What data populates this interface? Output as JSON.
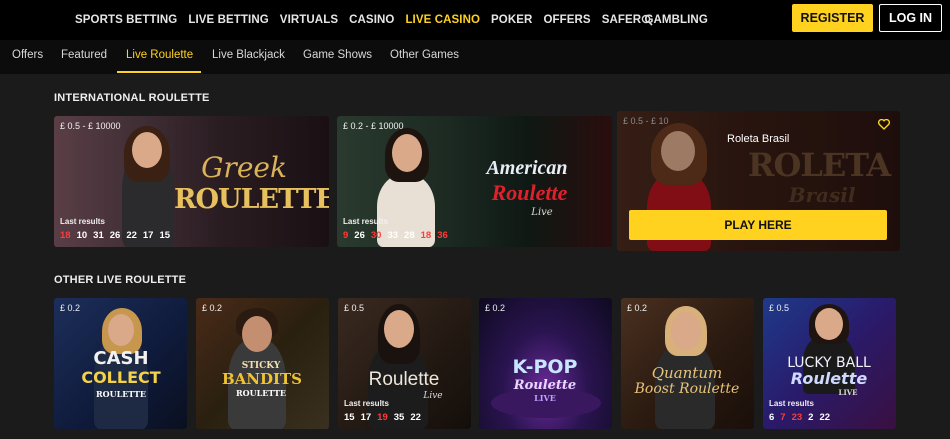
{
  "nav": {
    "items": [
      "SPORTS BETTING",
      "LIVE BETTING",
      "VIRTUALS",
      "CASINO",
      "LIVE CASINO",
      "POKER",
      "OFFERS",
      "SAFER GAMBLING"
    ],
    "active": "LIVE CASINO",
    "search_icon": "search-icon",
    "register": "REGISTER",
    "login": "LOG IN"
  },
  "tabs": [
    "Offers",
    "Featured",
    "Live Roulette",
    "Live Blackjack",
    "Game Shows",
    "Other Games"
  ],
  "active_tab": "Live Roulette",
  "sections": {
    "international": "INTERNATIONAL ROULETTE",
    "other": "OTHER LIVE ROULETTE"
  },
  "international_cards": [
    {
      "price": "£ 0.5  -  £ 10000",
      "logo_line1": "Greek",
      "logo_line2": "ROULETTE",
      "last_results_label": "Last results",
      "results": [
        {
          "n": "18",
          "red": true
        },
        {
          "n": "10",
          "red": false
        },
        {
          "n": "31",
          "red": false
        },
        {
          "n": "26",
          "red": false
        },
        {
          "n": "22",
          "red": false
        },
        {
          "n": "17",
          "red": false
        },
        {
          "n": "15",
          "red": false
        }
      ]
    },
    {
      "price": "£ 0.2  -  £ 10000",
      "logo_line1": "American",
      "logo_line2": "Roulette",
      "logo_line3": "Live",
      "last_results_label": "Last results",
      "results": [
        {
          "n": "9",
          "red": true
        },
        {
          "n": "26",
          "red": false
        },
        {
          "n": "30",
          "red": true
        },
        {
          "n": "33",
          "red": false
        },
        {
          "n": "28",
          "red": false
        },
        {
          "n": "18",
          "red": true
        },
        {
          "n": "36",
          "red": true
        }
      ]
    },
    {
      "price": "£ 0.5  -  £ 10",
      "name": "Roleta Brasil",
      "logo_line1": "ROLETA",
      "logo_line2": "Brasil",
      "play": "PLAY HERE",
      "heart_icon": "heart-icon"
    }
  ],
  "other_cards": [
    {
      "price": "£ 0.2",
      "logo_line1": "CASH",
      "logo_line2": "COLLECT",
      "logo_line3": "ROULETTE"
    },
    {
      "price": "£ 0.2",
      "logo_line1": "STICKY",
      "logo_line2": "BANDITS",
      "logo_line3": "ROULETTE"
    },
    {
      "price": "£ 0.5",
      "logo_line1": "Roulette",
      "logo_line2": "Live",
      "last_results_label": "Last results",
      "results": [
        {
          "n": "15",
          "red": false
        },
        {
          "n": "17",
          "red": false
        },
        {
          "n": "19",
          "red": true
        },
        {
          "n": "35",
          "red": false
        },
        {
          "n": "22",
          "red": false
        }
      ]
    },
    {
      "price": "£ 0.2",
      "logo_line1": "K-POP",
      "logo_line2": "Roulette",
      "logo_line3": "LIVE"
    },
    {
      "price": "£ 0.2",
      "logo_line1": "Quantum",
      "logo_line2": "Boost Roulette"
    },
    {
      "price": "£ 0.5",
      "logo_line1": "LUCKY BALL",
      "logo_line2": "Roulette",
      "logo_line3": "LIVE",
      "last_results_label": "Last results",
      "results": [
        {
          "n": "6",
          "red": false
        },
        {
          "n": "7",
          "red": true
        },
        {
          "n": "23",
          "red": true
        },
        {
          "n": "2",
          "red": false
        },
        {
          "n": "22",
          "red": false
        }
      ]
    }
  ],
  "colors": {
    "accent": "#ffd21f",
    "red_number": "#ff3b3b"
  }
}
